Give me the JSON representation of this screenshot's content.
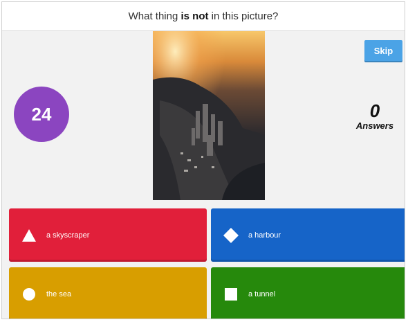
{
  "question": {
    "prefix": "What thing ",
    "emphasis": "is not",
    "suffix": " in this picture?"
  },
  "timer": {
    "value": "24"
  },
  "skip_button": {
    "label": "Skip"
  },
  "answers_counter": {
    "count": "0",
    "label": "Answers"
  },
  "options": [
    {
      "label": "a skyscraper",
      "shape": "triangle-icon",
      "color": "#e11f3a"
    },
    {
      "label": "a harbour",
      "shape": "diamond-icon",
      "color": "#1664c8"
    },
    {
      "label": "the sea",
      "shape": "circle-icon",
      "color": "#d89e00"
    },
    {
      "label": "a tunnel",
      "shape": "square-icon",
      "color": "#26890c"
    }
  ]
}
